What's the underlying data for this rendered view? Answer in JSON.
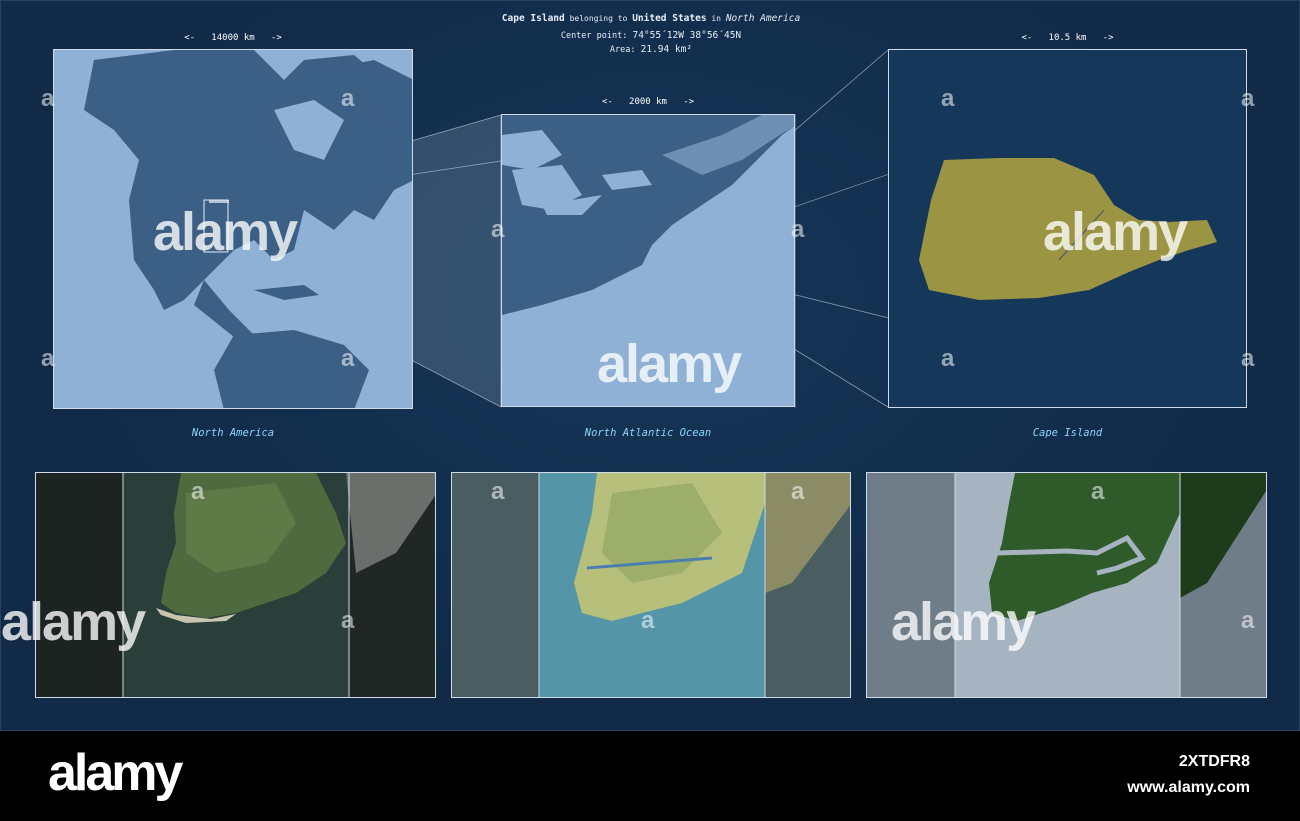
{
  "header": {
    "feature_name": "Cape Island",
    "belonging_text": " belonging to ",
    "country": "United States",
    "in_text": " in ",
    "continent": "North America",
    "center_label": "Center point: ",
    "center_value": "74°55´12W  38°56´45N",
    "area_label": "Area: ",
    "area_value": "21.94 km²"
  },
  "panels": [
    {
      "scale": "<-   14000 km   ->",
      "caption": "North America"
    },
    {
      "scale": "<-   2000 km   ->",
      "caption": "North Atlantic Ocean"
    },
    {
      "scale": "<-   10.5 km   ->",
      "caption": "Cape Island"
    }
  ],
  "watermark": {
    "word": "alamy",
    "letter": "a"
  },
  "footer": {
    "logo": "alamy",
    "image_id": "2XTDFR8",
    "url": "www.alamy.com"
  },
  "colors": {
    "background": "#102a47",
    "land_dark": "#3c5f85",
    "water_light": "#8fb1d6",
    "island": "#9b9443",
    "caption": "#8fd3ff"
  }
}
